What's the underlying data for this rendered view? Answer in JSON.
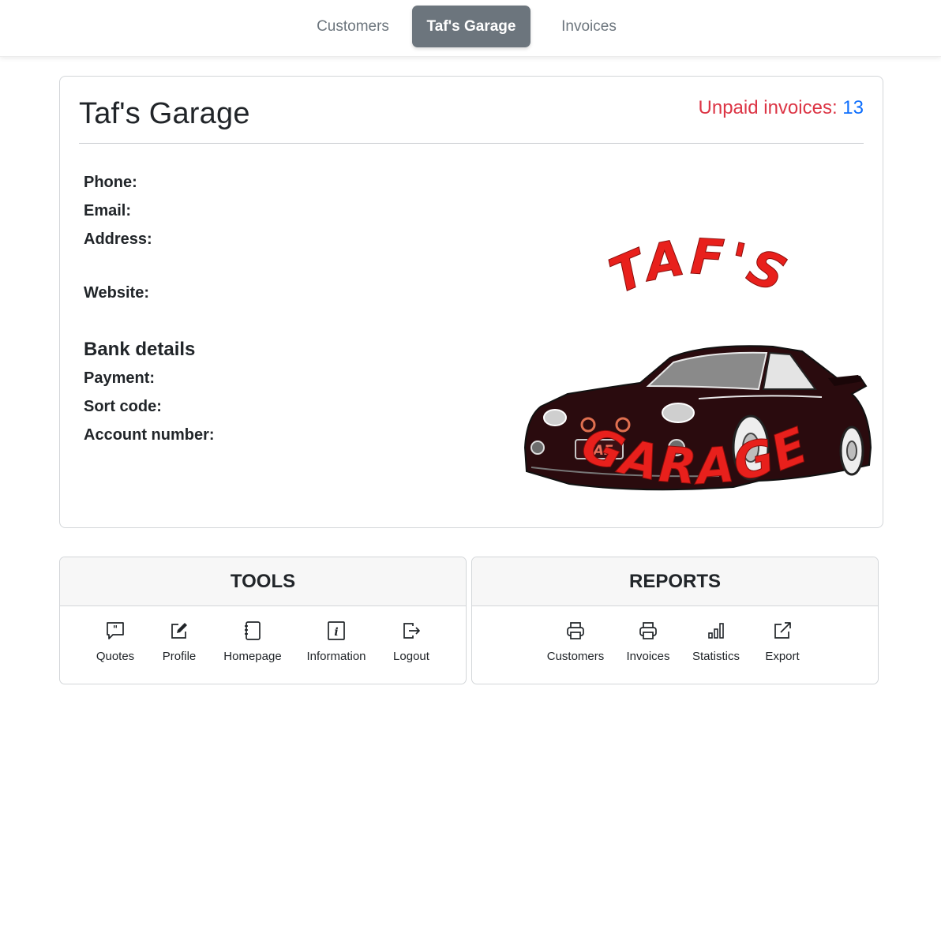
{
  "nav": {
    "items": [
      {
        "label": "Customers",
        "active": false
      },
      {
        "label": "Taf's Garage",
        "active": true
      },
      {
        "label": "Invoices",
        "active": false
      }
    ]
  },
  "garage": {
    "title": "Taf's Garage",
    "unpaid_label": "Unpaid invoices:",
    "unpaid_count": "13",
    "details": {
      "phone_label": "Phone:",
      "email_label": "Email:",
      "address_label": "Address:",
      "website_label": "Website:"
    },
    "bank": {
      "heading": "Bank details",
      "payment_label": "Payment:",
      "sort_code_label": "Sort code:",
      "account_number_label": "Account number:"
    },
    "logo": {
      "top_text": "TAF'S",
      "bottom_text": "GARAGE",
      "plate_text": "TAF",
      "text_color": "#e8201c",
      "car_color": "#2a0b0e"
    }
  },
  "tools": {
    "header": "TOOLS",
    "items": [
      {
        "label": "Quotes",
        "icon": "quote-icon"
      },
      {
        "label": "Profile",
        "icon": "edit-icon"
      },
      {
        "label": "Homepage",
        "icon": "notebook-icon"
      },
      {
        "label": "Information",
        "icon": "info-icon"
      },
      {
        "label": "Logout",
        "icon": "logout-icon"
      }
    ]
  },
  "reports": {
    "header": "REPORTS",
    "items": [
      {
        "label": "Customers",
        "icon": "printer-icon"
      },
      {
        "label": "Invoices",
        "icon": "printer-icon"
      },
      {
        "label": "Statistics",
        "icon": "bar-chart-icon"
      },
      {
        "label": "Export",
        "icon": "export-icon"
      }
    ]
  },
  "colors": {
    "nav_active_bg": "#6c757d",
    "unpaid_label": "#dc3545",
    "unpaid_count": "#0d6efd",
    "panel_header_bg": "#f7f7f7"
  }
}
